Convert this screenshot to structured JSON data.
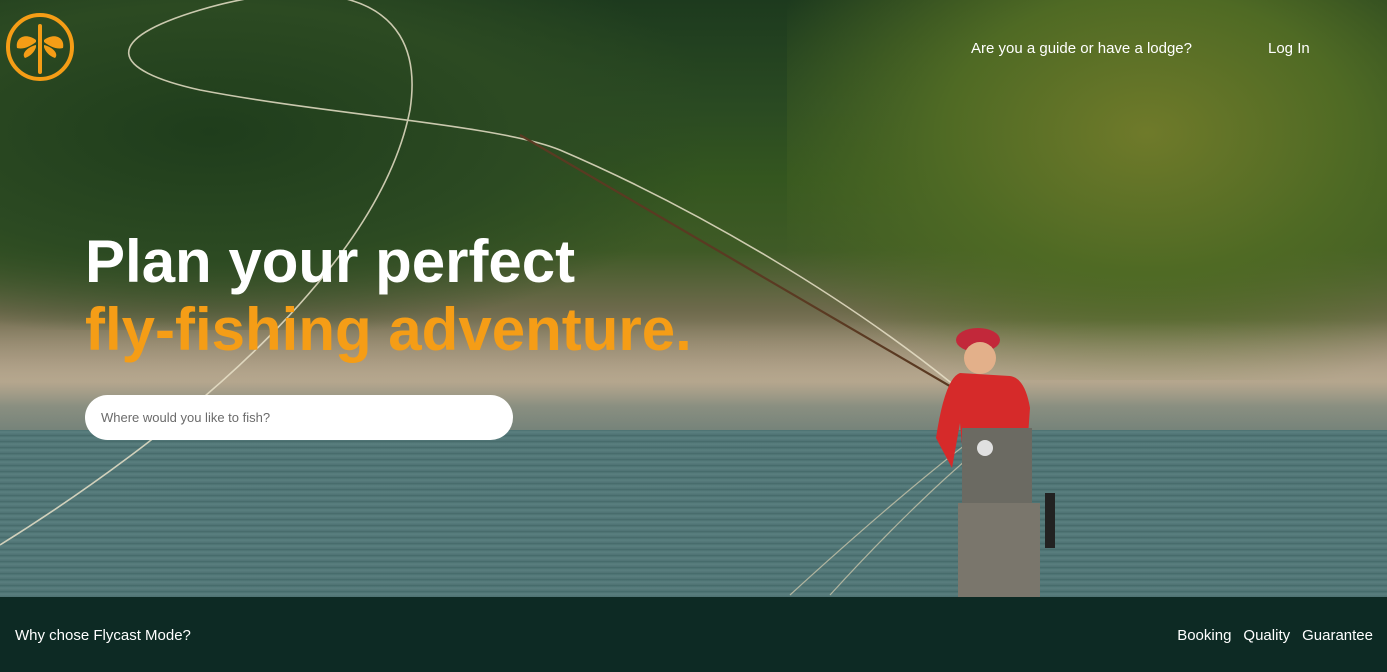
{
  "header": {
    "logo_icon": "fly-logo-icon",
    "guide_link": "Are you a guide or have a lodge?",
    "login_link": "Log In"
  },
  "hero": {
    "headline_line1": "Plan your perfect",
    "headline_line2": "fly-fishing adventure.",
    "search_placeholder": "Where would you like to fish?",
    "accent_color": "#f59d16"
  },
  "footer": {
    "question": "Why chose Flycast Mode?",
    "links": [
      "Booking",
      "Quality",
      "Guarantee"
    ]
  }
}
